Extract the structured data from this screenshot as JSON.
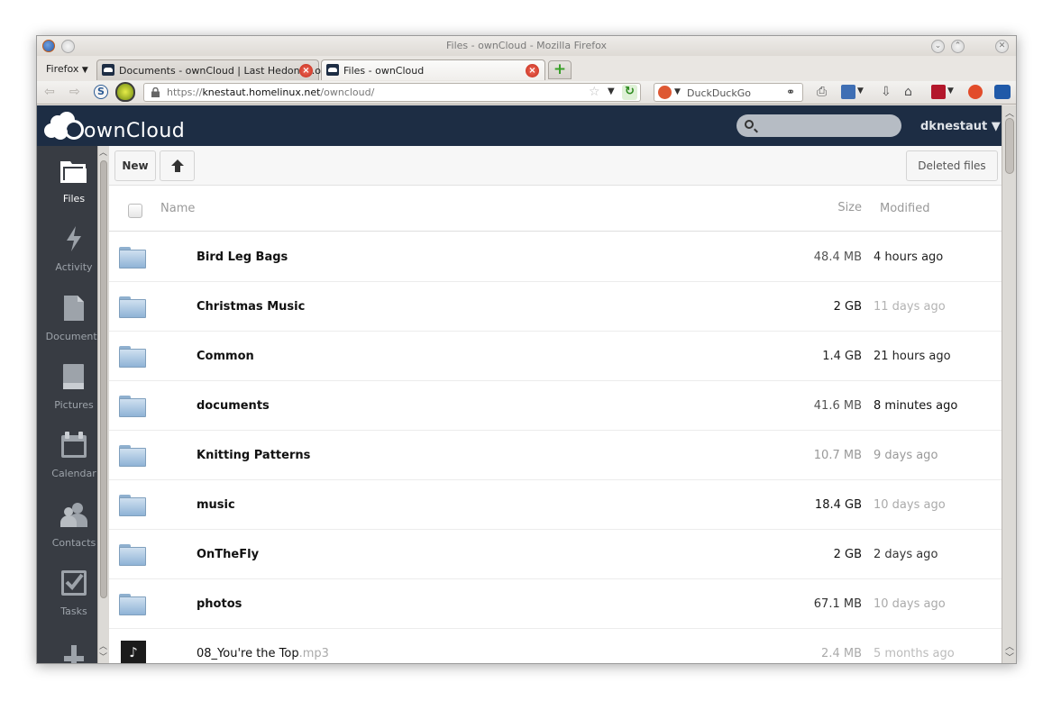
{
  "window": {
    "title": "Files - ownCloud - Mozilla Firefox"
  },
  "firefox_menu": "Firefox",
  "tabs": [
    {
      "label": "Documents - ownCloud | Last Hedonist.odt",
      "active": false
    },
    {
      "label": "Files - ownCloud",
      "active": true
    }
  ],
  "urlbar": {
    "protocol": "https://",
    "host": "knestaut.homelinux.net",
    "path": "/owncloud/"
  },
  "searchbar": {
    "placeholder": "DuckDuckGo"
  },
  "app": {
    "logo_text": "ownCloud",
    "user": "dknestaut ▼"
  },
  "sidebar": {
    "items": [
      {
        "label": "Files",
        "icon": "folder-icon",
        "active": true
      },
      {
        "label": "Activity",
        "icon": "lightning-icon",
        "active": false
      },
      {
        "label": "Documents",
        "icon": "document-icon",
        "active": false
      },
      {
        "label": "Pictures",
        "icon": "picture-icon",
        "active": false
      },
      {
        "label": "Calendar",
        "icon": "calendar-icon",
        "active": false
      },
      {
        "label": "Contacts",
        "icon": "contacts-icon",
        "active": false
      },
      {
        "label": "Tasks",
        "icon": "tasks-icon",
        "active": false
      }
    ]
  },
  "controls": {
    "new_label": "New",
    "deleted_label": "Deleted files"
  },
  "table": {
    "headers": {
      "name": "Name",
      "size": "Size",
      "modified": "Modified"
    },
    "rows": [
      {
        "name": "Bird Leg Bags",
        "ext": "",
        "type": "folder",
        "size": "48.4 MB",
        "modified": "4 hours ago",
        "size_color": "#555555",
        "mod_color": "#222222"
      },
      {
        "name": "Christmas Music",
        "ext": "",
        "type": "folder",
        "size": "2 GB",
        "modified": "11 days ago",
        "size_color": "#111111",
        "mod_color": "#b3b3b3"
      },
      {
        "name": "Common",
        "ext": "",
        "type": "folder",
        "size": "1.4 GB",
        "modified": "21 hours ago",
        "size_color": "#222222",
        "mod_color": "#222222"
      },
      {
        "name": "documents",
        "ext": "",
        "type": "folder",
        "size": "41.6 MB",
        "modified": "8 minutes ago",
        "size_color": "#555555",
        "mod_color": "#111111"
      },
      {
        "name": "Knitting Patterns",
        "ext": "",
        "type": "folder",
        "size": "10.7 MB",
        "modified": "9 days ago",
        "size_color": "#999999",
        "mod_color": "#999999"
      },
      {
        "name": "music",
        "ext": "",
        "type": "folder",
        "size": "18.4 GB",
        "modified": "10 days ago",
        "size_color": "#111111",
        "mod_color": "#aaaaaa"
      },
      {
        "name": "OnTheFly",
        "ext": "",
        "type": "folder",
        "size": "2 GB",
        "modified": "2 days ago",
        "size_color": "#111111",
        "mod_color": "#333333"
      },
      {
        "name": "photos",
        "ext": "",
        "type": "folder",
        "size": "67.1 MB",
        "modified": "10 days ago",
        "size_color": "#333333",
        "mod_color": "#aaaaaa"
      },
      {
        "name": "08_You're the Top",
        "ext": ".mp3",
        "type": "audio",
        "size": "2.4 MB",
        "modified": "5 months ago",
        "size_color": "#aaaaaa",
        "mod_color": "#bbbbbb"
      }
    ]
  },
  "colors": {
    "header_bg": "#1d2d44",
    "sidebar_bg": "#383c43"
  }
}
